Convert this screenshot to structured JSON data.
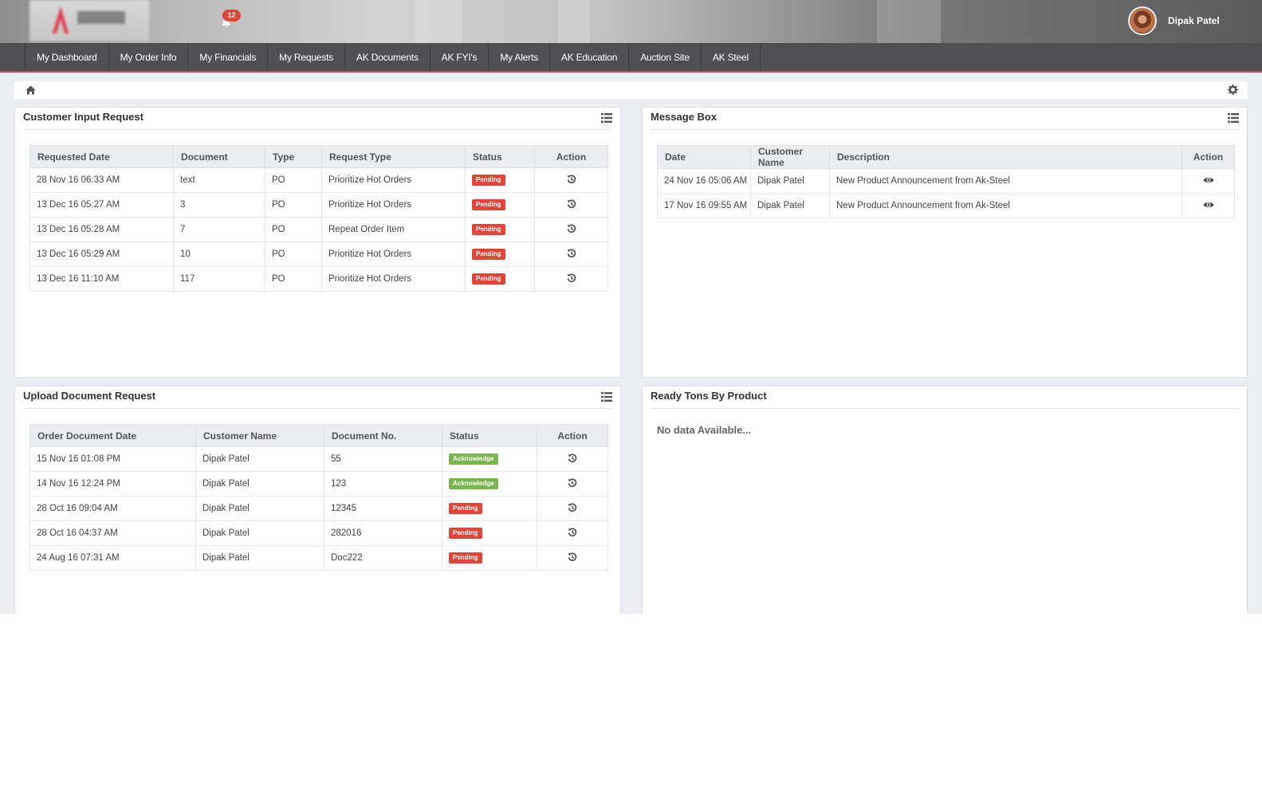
{
  "header": {
    "notification_count": "12",
    "user_name": "Dipak Patel"
  },
  "nav": {
    "items": [
      "My Dashboard",
      "My Order Info",
      "My Financials",
      "My Requests",
      "AK Documents",
      "AK FYI's",
      "My Alerts",
      "AK Education",
      "Auction Site",
      "AK Steel"
    ]
  },
  "customer_input": {
    "title": "Customer Input Request",
    "columns": [
      "Requested Date",
      "Document",
      "Type",
      "Request Type",
      "Status",
      "Action"
    ],
    "rows": [
      {
        "date": "28 Nov 16 06:33 AM",
        "document": "text",
        "type": "PO",
        "request_type": "Prioritize Hot Orders",
        "status": "Pending"
      },
      {
        "date": "13 Dec 16 05:27 AM",
        "document": "3",
        "type": "PO",
        "request_type": "Prioritize Hot Orders",
        "status": "Pending"
      },
      {
        "date": "13 Dec 16 05:28 AM",
        "document": "7",
        "type": "PO",
        "request_type": "Repeat Order Item",
        "status": "Pending"
      },
      {
        "date": "13 Dec 16 05:29 AM",
        "document": "10",
        "type": "PO",
        "request_type": "Prioritize Hot Orders",
        "status": "Pending"
      },
      {
        "date": "13 Dec 16 11:10 AM",
        "document": "117",
        "type": "PO",
        "request_type": "Prioritize Hot Orders",
        "status": "Pending"
      }
    ]
  },
  "message_box": {
    "title": "Message Box",
    "columns": [
      "Date",
      "Customer Name",
      "Description",
      "Action"
    ],
    "rows": [
      {
        "date": "24 Nov 16 05:06 AM",
        "customer": "Dipak Patel",
        "description": "New Product Announcement from Ak-Steel"
      },
      {
        "date": "17 Nov 16 09:55 AM",
        "customer": "Dipak Patel",
        "description": "New Product Announcement from Ak-Steel"
      }
    ]
  },
  "upload_document": {
    "title": "Upload Document Request",
    "columns": [
      "Order Document Date",
      "Customer Name",
      "Document No.",
      "Status",
      "Action"
    ],
    "rows": [
      {
        "date": "15 Nov 16 01:08 PM",
        "customer": "Dipak Patel",
        "doc_no": "55",
        "status": "Acknowledge"
      },
      {
        "date": "14 Nov 16 12:24 PM",
        "customer": "Dipak Patel",
        "doc_no": "123",
        "status": "Acknowledge"
      },
      {
        "date": "28 Oct 16 09:04 AM",
        "customer": "Dipak Patel",
        "doc_no": "12345",
        "status": "Pending"
      },
      {
        "date": "28 Oct 16 04:37 AM",
        "customer": "Dipak Patel",
        "doc_no": "282016",
        "status": "Pending"
      },
      {
        "date": "24 Aug 16 07:31 AM",
        "customer": "Dipak Patel",
        "doc_no": "Doc222",
        "status": "Pending"
      }
    ]
  },
  "ready_tons": {
    "title": "Ready Tons By Product",
    "empty_text": "No data Available..."
  },
  "colors": {
    "pending": "#e0453b",
    "acknowledge": "#7ab54d",
    "nav_bg": "#4f5054",
    "accent": "#d44450"
  },
  "icons": {
    "home": "home-icon",
    "settings": "gear-icon",
    "panel_menu": "list-icon",
    "history_action": "history-icon",
    "view_action": "eye-icon",
    "notifications": "bell-icon"
  }
}
